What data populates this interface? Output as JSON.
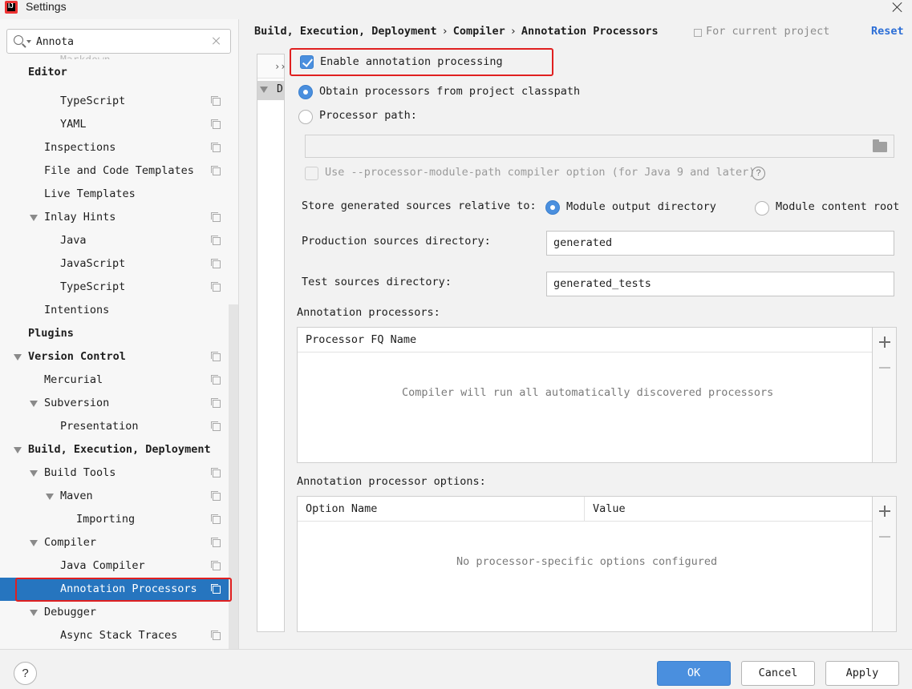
{
  "window": {
    "title": "Settings"
  },
  "search": {
    "value": "Annota"
  },
  "tree": {
    "faded_item": "Markdown",
    "items": [
      {
        "label": "Editor"
      },
      {
        "label": "TypeScript"
      },
      {
        "label": "YAML"
      },
      {
        "label": "Inspections"
      },
      {
        "label": "File and Code Templates"
      },
      {
        "label": "Live Templates"
      },
      {
        "label": "Inlay Hints"
      },
      {
        "label": "Java"
      },
      {
        "label": "JavaScript"
      },
      {
        "label": "TypeScript"
      },
      {
        "label": "Intentions"
      },
      {
        "label": "Plugins"
      },
      {
        "label": "Version Control"
      },
      {
        "label": "Mercurial"
      },
      {
        "label": "Subversion"
      },
      {
        "label": "Presentation"
      },
      {
        "label": "Build, Execution, Deployment"
      },
      {
        "label": "Build Tools"
      },
      {
        "label": "Maven"
      },
      {
        "label": "Importing"
      },
      {
        "label": "Compiler"
      },
      {
        "label": "Java Compiler"
      },
      {
        "label": "Annotation Processors"
      },
      {
        "label": "Debugger"
      },
      {
        "label": "Async Stack Traces"
      }
    ]
  },
  "breadcrumb": {
    "parts": [
      "Build, Execution, Deployment",
      "Compiler",
      "Annotation Processors"
    ],
    "separator": "›"
  },
  "scope_label": "For current project",
  "reset_label": "Reset",
  "module_panel": {
    "expand": "››",
    "row_label": "D"
  },
  "form": {
    "enable_label": "Enable annotation processing",
    "enable_checked": true,
    "obtain_label": "Obtain processors from project classpath",
    "processor_path_label": "Processor path:",
    "module_path_label": "Use --processor-module-path compiler option (for Java 9 and later)",
    "help_glyph": "?",
    "store_label": "Store generated sources relative to:",
    "module_output_label": "Module output directory",
    "module_content_label": "Module content root",
    "prod_dir_label": "Production sources directory:",
    "prod_dir_value": "generated",
    "test_dir_label": "Test sources directory:",
    "test_dir_value": "generated_tests"
  },
  "processors_table": {
    "title": "Annotation processors:",
    "columns": [
      "Processor FQ Name"
    ],
    "empty_text": "Compiler will run all automatically discovered processors"
  },
  "options_table": {
    "title": "Annotation processor options:",
    "columns": [
      "Option Name",
      "Value"
    ],
    "empty_text": "No processor-specific options configured"
  },
  "buttons": {
    "help": "?",
    "ok": "OK",
    "cancel": "Cancel",
    "apply": "Apply"
  },
  "colors": {
    "accent": "#4a8fde",
    "selection": "#2675bf",
    "highlight": "#e02020",
    "link": "#2c6ed6"
  }
}
